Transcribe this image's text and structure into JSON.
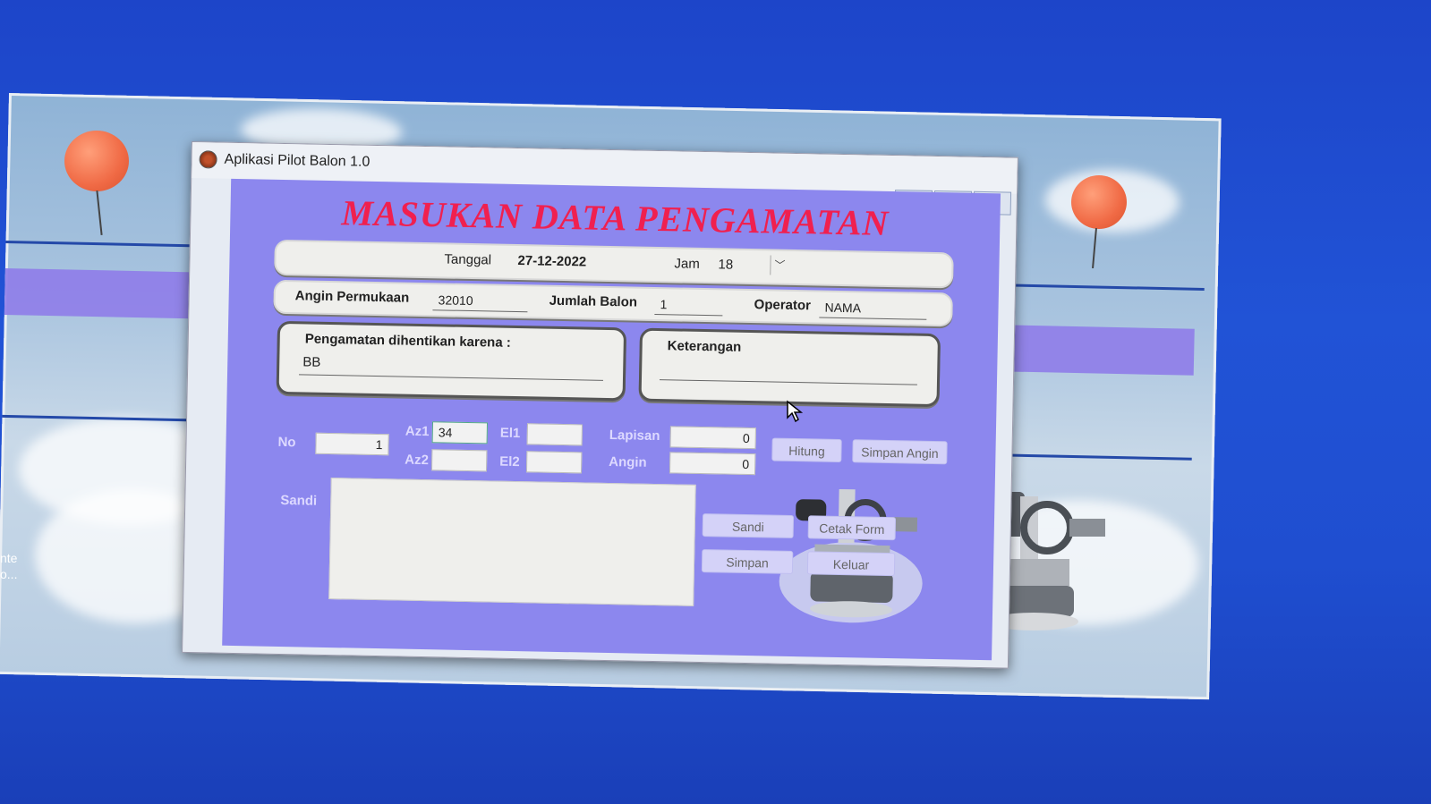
{
  "window": {
    "title": "Aplikasi Pilot Balon 1.0",
    "heading": "MASUKAN DATA PENGAMATAN",
    "controls": {
      "minimize": "▭",
      "maximize": "▣",
      "close": "☒"
    }
  },
  "form": {
    "tanggal_label": "Tanggal",
    "tanggal_value": "27-12-2022",
    "jam_label": "Jam",
    "jam_value": "18",
    "angin_permukaan_label": "Angin Permukaan",
    "angin_permukaan_value": "32010",
    "jumlah_balon_label": "Jumlah Balon",
    "jumlah_balon_value": "1",
    "operator_label": "Operator",
    "operator_value": "NAMA",
    "pengamatan_label": "Pengamatan dihentikan karena :",
    "pengamatan_value": "BB",
    "keterangan_label": "Keterangan",
    "keterangan_value": ""
  },
  "observation": {
    "no_label": "No",
    "no_value": "1",
    "az1_label": "Az1",
    "az1_value": "34",
    "az2_label": "Az2",
    "az2_value": "",
    "el1_label": "El1",
    "el1_value": "",
    "el2_label": "El2",
    "el2_value": "",
    "lapisan_label": "Lapisan",
    "lapisan_value": "0",
    "angin_label": "Angin",
    "angin_value": "0",
    "sandi_label": "Sandi"
  },
  "buttons": {
    "hitung": "Hitung",
    "simpan_angin": "Simpan Angin",
    "sandi": "Sandi",
    "cetak_form": "Cetak Form",
    "simpan": "Simpan",
    "keluar": "Keluar"
  },
  "desktop": {
    "icon_label": "nte\no..."
  },
  "colors": {
    "accent_heading": "#f0204f",
    "client_bg": "#8c87ee",
    "desktop_bg": "#2153d6"
  }
}
